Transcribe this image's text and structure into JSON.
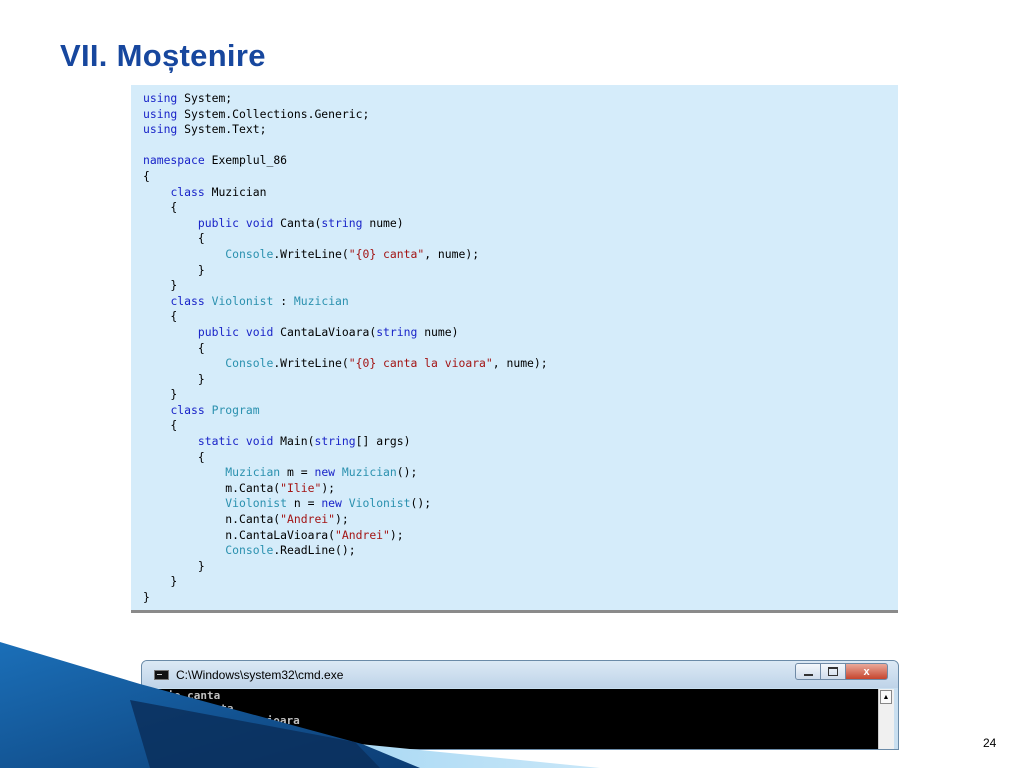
{
  "slide": {
    "title": "VII. Moștenire",
    "page_number": "24"
  },
  "code": {
    "lines": [
      [
        [
          "kw",
          "using"
        ],
        [
          "",
          "System;"
        ]
      ],
      [
        [
          "kw",
          "using"
        ],
        [
          "",
          "System.Collections.Generic;"
        ]
      ],
      [
        [
          "kw",
          "using"
        ],
        [
          "",
          "System.Text;"
        ]
      ],
      [],
      [
        [
          "kw",
          "namespace"
        ],
        [
          "",
          "Exemplul_86"
        ]
      ],
      [
        [
          "",
          "{"
        ]
      ],
      [
        [
          "",
          "    "
        ],
        [
          "kw",
          "class"
        ],
        [
          "",
          "Muzician"
        ]
      ],
      [
        [
          "",
          "    {"
        ]
      ],
      [
        [
          "",
          "        "
        ],
        [
          "kw",
          "public void"
        ],
        [
          "",
          "Canta("
        ],
        [
          "kw",
          "string"
        ],
        [
          "",
          "nume)"
        ]
      ],
      [
        [
          "",
          "        {"
        ]
      ],
      [
        [
          "",
          "            "
        ],
        [
          "ty",
          "Console"
        ],
        [
          "",
          ".WriteLine("
        ],
        [
          "str",
          "\"{0} canta\""
        ],
        [
          "",
          ", nume);"
        ]
      ],
      [
        [
          "",
          "        }"
        ]
      ],
      [
        [
          "",
          "    }"
        ]
      ],
      [
        [
          "",
          "    "
        ],
        [
          "kw",
          "class"
        ],
        [
          "ty",
          "Violonist"
        ],
        [
          "",
          ":"
        ],
        [
          "ty",
          "Muzician"
        ]
      ],
      [
        [
          "",
          "    {"
        ]
      ],
      [
        [
          "",
          "        "
        ],
        [
          "kw",
          "public void"
        ],
        [
          "",
          "CantaLaVioara("
        ],
        [
          "kw",
          "string"
        ],
        [
          "",
          "nume)"
        ]
      ],
      [
        [
          "",
          "        {"
        ]
      ],
      [
        [
          "",
          "            "
        ],
        [
          "ty",
          "Console"
        ],
        [
          "",
          ".WriteLine("
        ],
        [
          "str",
          "\"{0} canta la vioara\""
        ],
        [
          "",
          ", nume);"
        ]
      ],
      [
        [
          "",
          "        }"
        ]
      ],
      [
        [
          "",
          "    }"
        ]
      ],
      [
        [
          "",
          "    "
        ],
        [
          "kw",
          "class"
        ],
        [
          "ty",
          "Program"
        ]
      ],
      [
        [
          "",
          "    {"
        ]
      ],
      [
        [
          "",
          "        "
        ],
        [
          "kw",
          "static void"
        ],
        [
          "",
          "Main("
        ],
        [
          "kw",
          "string"
        ],
        [
          "",
          "[] args)"
        ]
      ],
      [
        [
          "",
          "        {"
        ]
      ],
      [
        [
          "",
          "            "
        ],
        [
          "ty",
          "Muzician"
        ],
        [
          "",
          "m ="
        ],
        [
          "kw",
          "new"
        ],
        [
          "ty",
          "Muzician"
        ],
        [
          "",
          "();"
        ]
      ],
      [
        [
          "",
          "            m.Canta("
        ],
        [
          "str",
          "\"Ilie\""
        ],
        [
          "",
          ");"
        ]
      ],
      [
        [
          "",
          "            "
        ],
        [
          "ty",
          "Violonist"
        ],
        [
          "",
          "n ="
        ],
        [
          "kw",
          "new"
        ],
        [
          "ty",
          "Violonist"
        ],
        [
          "",
          "();"
        ]
      ],
      [
        [
          "",
          "            n.Canta("
        ],
        [
          "str",
          "\"Andrei\""
        ],
        [
          "",
          ");"
        ]
      ],
      [
        [
          "",
          "            n.CantaLaVioara("
        ],
        [
          "str",
          "\"Andrei\""
        ],
        [
          "",
          ");"
        ]
      ],
      [
        [
          "",
          "            "
        ],
        [
          "ty",
          "Console"
        ],
        [
          "",
          ".ReadLine();"
        ]
      ],
      [
        [
          "",
          "        }"
        ]
      ],
      [
        [
          "",
          "    }"
        ]
      ],
      [
        [
          "",
          "}"
        ]
      ]
    ]
  },
  "console_window": {
    "title": "C:\\Windows\\system32\\cmd.exe",
    "close_label": "x",
    "output_lines": [
      "Ilie canta",
      "Andrei canta",
      "Andrei canta la vioara"
    ],
    "scroll_up_glyph": "▲",
    "scroll_down_glyph": "▼"
  },
  "colors": {
    "title": "#17479e",
    "keyword": "#1a24c8",
    "type": "#2b91af",
    "string": "#a31515",
    "code_background": "#d5ecfa"
  }
}
